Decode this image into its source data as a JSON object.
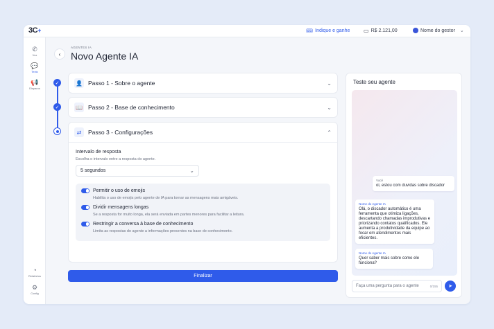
{
  "brand": {
    "logo": "3C",
    "logo_plus": "+"
  },
  "topbar": {
    "indique_label": "Indique e ganhe",
    "balance": "R$ 2.121,00",
    "manager_name": "Nome do gestor"
  },
  "sidebar": {
    "items": [
      {
        "label": "Voz",
        "icon": "phone-icon"
      },
      {
        "label": "Texto",
        "icon": "chat-icon"
      },
      {
        "label": "Disparos",
        "icon": "megaphone-icon"
      }
    ],
    "bottom": [
      {
        "label": "Relatórios",
        "icon": "chart-icon"
      },
      {
        "label": "Config",
        "icon": "gear-icon"
      }
    ]
  },
  "header": {
    "breadcrumb": "AGENTES IA",
    "title": "Novo Agente IA"
  },
  "steps": [
    {
      "title": "Passo 1 - Sobre o agente",
      "icon": "user-icon",
      "state": "done"
    },
    {
      "title": "Passo 2 - Base de conhecimento",
      "icon": "book-icon",
      "state": "done"
    },
    {
      "title": "Passo 3 - Configurações",
      "icon": "swap-icon",
      "state": "current"
    }
  ],
  "config": {
    "interval_label": "Intervalo de resposta",
    "interval_hint": "Escolha o intervalo entre a resposta do agente.",
    "interval_value": "5 segundos",
    "options": [
      {
        "title": "Permitir o uso de emojis",
        "desc": "Habilita o uso de emojis pelo agente de IA para tornar as mensagens mais amigáveis.",
        "enabled": true
      },
      {
        "title": "Dividir mensagens longas",
        "desc": "Se a resposta for muito longa, ela será enviada em partes menores para facilitar a leitura.",
        "enabled": true
      },
      {
        "title": "Restringir a conversa à base de conhecimento",
        "desc": "Limita as respostas do agente a informações presentes na base de conhecimento.",
        "enabled": true
      }
    ]
  },
  "finalize_label": "Finalizar",
  "chat": {
    "title": "Teste seu agente",
    "messages": [
      {
        "sender": "Você",
        "text": "oi, estou com duvidas sobre discador"
      },
      {
        "sender": "Nome do Agente IA",
        "text": "Olá, o discador automático é uma ferramenta que otimiza ligações, descartando chamadas improdutivas e priorizando contatos qualificados. Ele aumenta a produtividade da equipe ao focar em atendimentos mais eficientes."
      },
      {
        "sender": "Nome do Agente IA",
        "text": "Quer saber mais sobre como ele funciona?"
      }
    ],
    "input_placeholder": "Faça uma pergunta para o agente",
    "counter": "0/155"
  },
  "colors": {
    "accent": "#2f5bea",
    "background": "#e4ebf8"
  }
}
